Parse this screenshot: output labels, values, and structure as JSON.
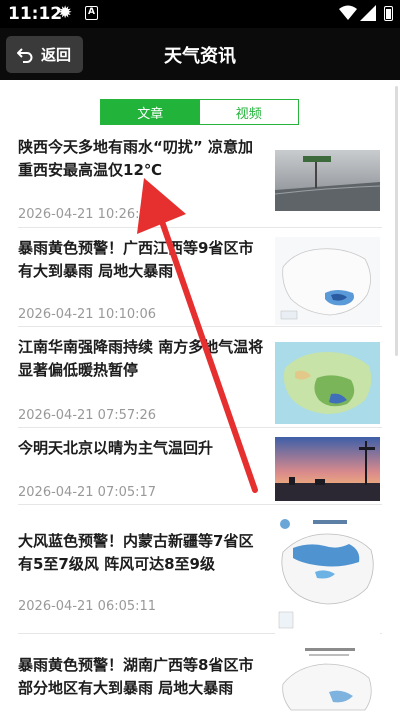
{
  "status_bar": {
    "time": "11:12",
    "icons": [
      "gear-icon",
      "a-notification-icon",
      "wifi-icon",
      "signal-icon",
      "battery-icon"
    ]
  },
  "header": {
    "back_label": "返回",
    "title": "天气资讯"
  },
  "tabs": [
    {
      "label": "文章",
      "active": true
    },
    {
      "label": "视频",
      "active": false
    }
  ],
  "news": [
    {
      "title": "陕西今天多地有雨水“叨扰” 凉意加重西安最高温仅12℃",
      "date": "2026-04-21 10:26:02",
      "thumb": "rainy-road-photo"
    },
    {
      "title": "暴雨黄色预警！广西江西等9省区市有大到暴雨 局地大暴雨",
      "date": "2026-04-21 10:10:06",
      "thumb": "rainfall-forecast-map"
    },
    {
      "title": "江南华南强降雨持续 南方多地气温将显著偏低暖热暂停",
      "date": "2026-04-21 07:57:26",
      "thumb": "temperature-map"
    },
    {
      "title": "今明天北京以晴为主气温回升",
      "date": "2026-04-21 07:05:17",
      "thumb": "sunset-city-photo"
    },
    {
      "title": "大风蓝色预警！内蒙古新疆等7省区有5至7级风 阵风可达8至9级",
      "date": "2026-04-21 06:05:11",
      "thumb": "wind-warning-map"
    },
    {
      "title": "暴雨黄色预警！湖南广西等8省区市部分地区有大到暴雨 局地大暴雨",
      "date": "",
      "thumb": "rainstorm-warning-map"
    }
  ],
  "colors": {
    "accent": "#22b43a",
    "annotation_arrow": "#e5302f",
    "title_bar": "#0b0b0b"
  }
}
